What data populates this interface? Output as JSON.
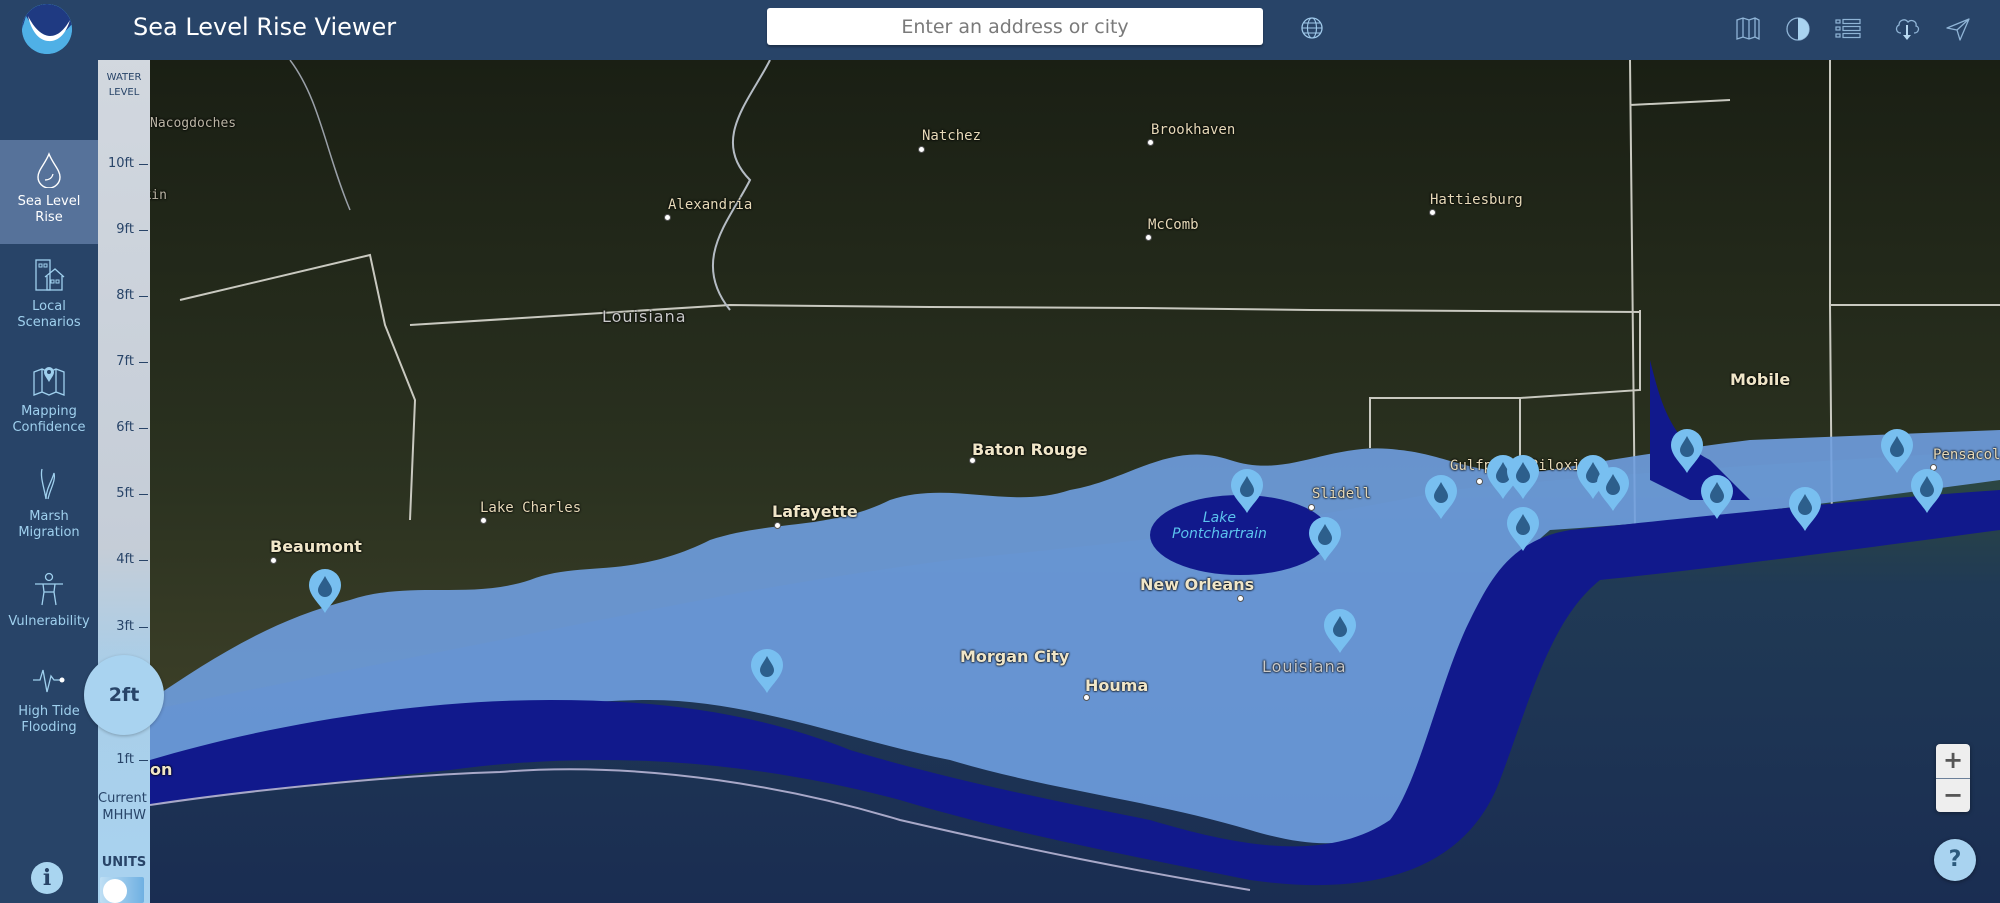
{
  "header": {
    "title": "Sea Level Rise Viewer",
    "search_placeholder": "Enter an address or city",
    "toolbar_icons": [
      "globe-icon",
      "basemap-icon",
      "contrast-icon",
      "legend-list-icon",
      "download-icon",
      "share-icon"
    ]
  },
  "sidebar": {
    "items": [
      {
        "label_line1": "Sea Level",
        "label_line2": "Rise",
        "icon": "water-drop-icon",
        "active": true
      },
      {
        "label_line1": "Local",
        "label_line2": "Scenarios",
        "icon": "buildings-icon",
        "active": false
      },
      {
        "label_line1": "Mapping",
        "label_line2": "Confidence",
        "icon": "map-pin-icon",
        "active": false
      },
      {
        "label_line1": "Marsh",
        "label_line2": "Migration",
        "icon": "marsh-icon",
        "active": false
      },
      {
        "label_line1": "Vulnerability",
        "label_line2": "",
        "icon": "person-icon",
        "active": false
      },
      {
        "label_line1": "High Tide",
        "label_line2": "Flooding",
        "icon": "tide-pulse-icon",
        "active": false
      }
    ],
    "info_label": "i"
  },
  "water_level": {
    "title_line1": "WATER",
    "title_line2": "LEVEL",
    "ticks": [
      "10ft",
      "9ft",
      "8ft",
      "7ft",
      "6ft",
      "5ft",
      "4ft",
      "3ft",
      "1ft"
    ],
    "baseline_line1": "Current",
    "baseline_line2": "MHHW",
    "selected": "2ft",
    "units_label": "UNITS"
  },
  "map": {
    "cities": [
      {
        "name": "Nacogdoches",
        "style": "dim"
      },
      {
        "name": "Lufkin",
        "style": "dim"
      },
      {
        "name": "Alexandria",
        "style": ""
      },
      {
        "name": "Natchez",
        "style": ""
      },
      {
        "name": "Brookhaven",
        "style": ""
      },
      {
        "name": "McComb",
        "style": ""
      },
      {
        "name": "Hattiesburg",
        "style": ""
      },
      {
        "name": "Louisiana",
        "style": "state"
      },
      {
        "name": "Baton Rouge",
        "style": "big"
      },
      {
        "name": "Lake Charles",
        "style": ""
      },
      {
        "name": "Lafayette",
        "style": "big"
      },
      {
        "name": "Beaumont",
        "style": "big"
      },
      {
        "name": "Slidell",
        "style": ""
      },
      {
        "name": "Gulfport",
        "style": ""
      },
      {
        "name": "Biloxi",
        "style": ""
      },
      {
        "name": "Mobile",
        "style": "big"
      },
      {
        "name": "Pensacola",
        "style": ""
      },
      {
        "name": "New Orleans",
        "style": "big"
      },
      {
        "name": "Morgan City",
        "style": "big"
      },
      {
        "name": "Houma",
        "style": "big"
      },
      {
        "name": "Louisiana",
        "style": "state"
      },
      {
        "name": "on",
        "style": "big"
      }
    ],
    "lake_label_line1": "Lake",
    "lake_label_line2": "Pontchartrain",
    "marker_icon": "water-drop-marker-icon"
  },
  "controls": {
    "zoom_in": "+",
    "zoom_out": "−",
    "help": "?"
  },
  "colors": {
    "header_bg": "#284468",
    "sidebar_active": "#56729a",
    "accent_light": "#a9d3f0",
    "inundation_deep": "#0f1a8c",
    "inundation_shallow": "#6fa2e0"
  }
}
